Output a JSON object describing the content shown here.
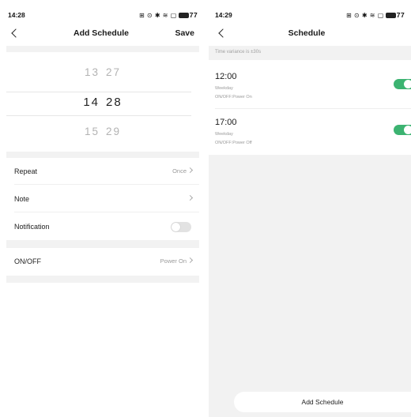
{
  "left": {
    "status": {
      "time": "14:28",
      "icons": "⊞ ⊙ ✱ ≋ ▢",
      "battery": "77"
    },
    "nav": {
      "title": "Add Schedule",
      "save": "Save"
    },
    "picker": {
      "rows": [
        {
          "hour": "13",
          "minute": "27"
        },
        {
          "hour": "14",
          "minute": "28"
        },
        {
          "hour": "15",
          "minute": "29"
        }
      ],
      "selected_index": 1
    },
    "rows": {
      "repeat": {
        "label": "Repeat",
        "value": "Once"
      },
      "note": {
        "label": "Note",
        "value": ""
      },
      "notification": {
        "label": "Notification",
        "enabled": false
      },
      "onoff": {
        "label": "ON/OFF",
        "value": "Power On"
      }
    }
  },
  "right": {
    "status": {
      "time": "14:29",
      "icons": "⊞ ⊙ ✱ ≋ ▢",
      "battery": "77"
    },
    "nav": {
      "title": "Schedule"
    },
    "variance_note": "Time variance is ±30s",
    "schedules": [
      {
        "time": "12:00",
        "repeat": "Weekday",
        "action": "ON/OFF:Power On",
        "enabled": true
      },
      {
        "time": "17:00",
        "repeat": "Weekday",
        "action": "ON/OFF:Power Off",
        "enabled": true
      }
    ],
    "add_button": "Add Schedule"
  },
  "colors": {
    "accent_green": "#3cb371",
    "band_gray": "#f2f2f2",
    "muted_text": "#9a9a9a"
  },
  "icons": [
    "back-chevron-icon",
    "chevron-right-icon",
    "battery-icon",
    "wifi-icon",
    "bluetooth-icon",
    "toggle-switch"
  ]
}
